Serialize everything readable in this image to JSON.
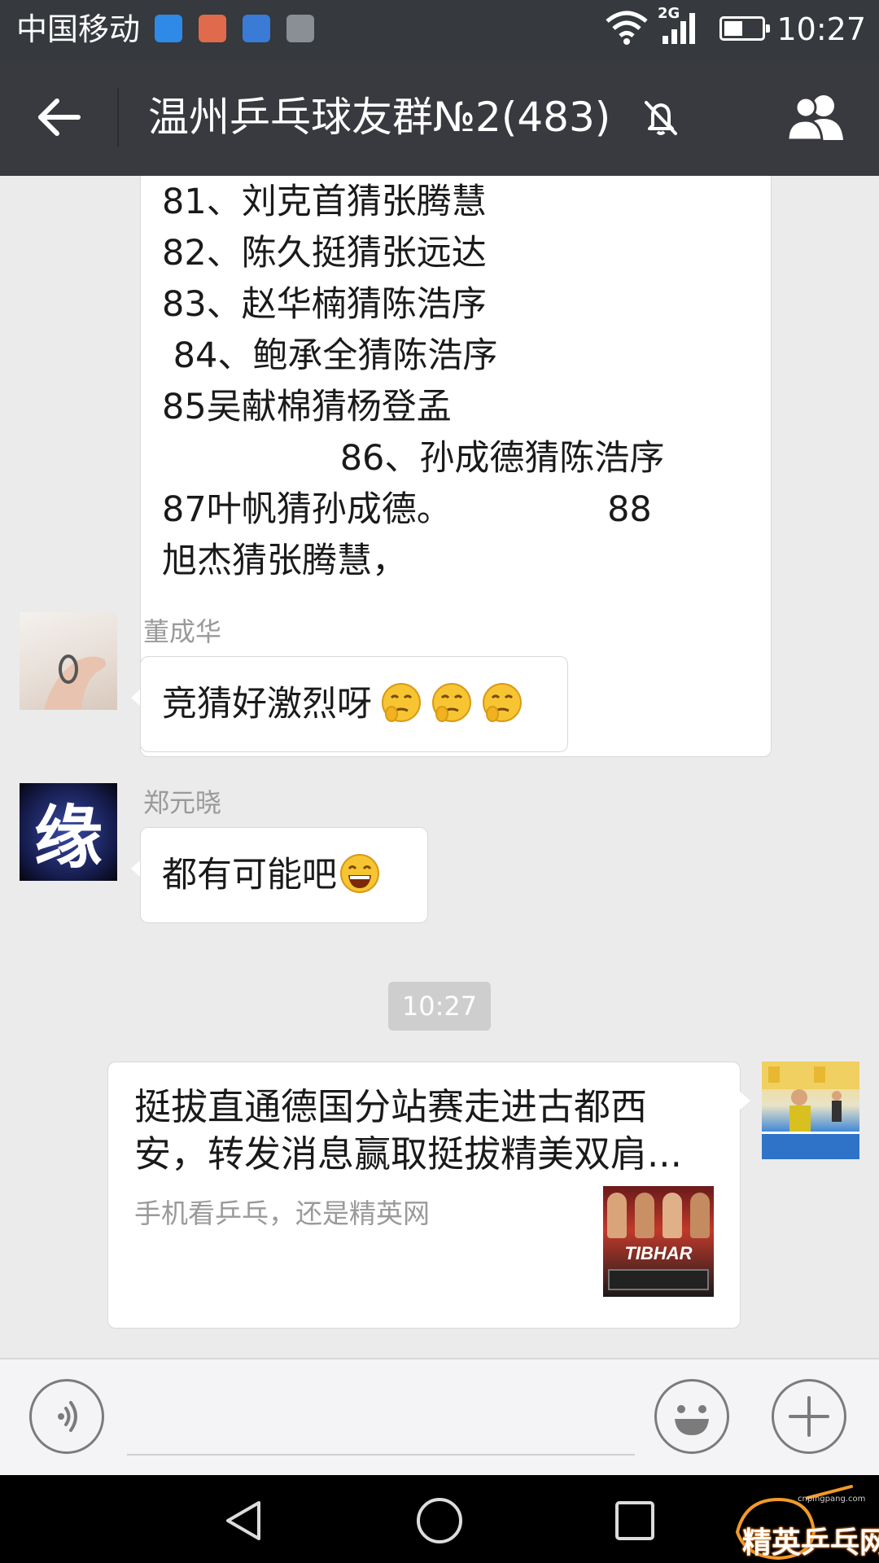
{
  "status_bar": {
    "carrier": "中国移动",
    "network": "2G",
    "time": "10:27"
  },
  "header": {
    "title": "温州乒乓球友群№2(483)"
  },
  "messages": {
    "long_message_lines": [
      "81、刘克首猜张腾慧",
      "82、陈久挺猜张远达",
      "83、赵华楠猜陈浩序",
      " 84、鲍承全猜陈浩序",
      "85吴献棉猜杨登孟",
      "                86、孙成德猜陈浩序",
      "87叶帆猜孙成德。              88",
      "旭杰猜张腾慧，"
    ],
    "msg2": {
      "sender": "董成华",
      "text": "竞猜好激烈呀"
    },
    "msg3": {
      "sender": "郑元晓",
      "text": "都有可能吧",
      "avatar_char": "缘"
    },
    "timestamp": "10:27",
    "link_card": {
      "title": "挺拔直通德国分站赛走进古都西安，转发消息赢取挺拔精美双肩...",
      "description": "手机看乒乓，还是精英网",
      "thumb_text": "TIBHAR"
    }
  },
  "watermark": {
    "text": "精英乒乓网",
    "url": "cnpingpang.com"
  },
  "colors": {
    "status_bar": "#36393d",
    "title_bar": "#393a3f",
    "chat_bg": "#ebebeb",
    "bubble": "#ffffff"
  }
}
